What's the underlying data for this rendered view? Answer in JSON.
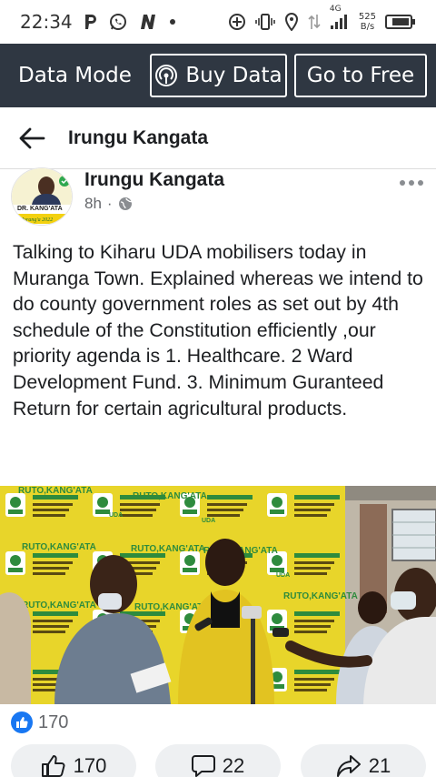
{
  "status_bar": {
    "time": "22:34",
    "network": "4G",
    "speed_value": "525",
    "speed_unit": "B/s"
  },
  "data_mode": {
    "label": "Data Mode",
    "buy_data": "Buy Data",
    "go_to_free": "Go to Free"
  },
  "header": {
    "title": "Irungu Kangata"
  },
  "post": {
    "author": "Irungu Kangata",
    "time": "8h",
    "avatar_caption": "DR. KANG'ATA",
    "avatar_sub": "Murang'a 2022",
    "text": "Talking to Kiharu  UDA mobilisers today in Muranga Town. Explained whereas we intend to do county government roles as set out by 4th schedule of the Constitution efficiently  ,our priority agenda is 1. Healthcare. 2 Ward Development Fund. 3. Minimum Guranteed Return for certain agricultural products.",
    "photo_banner_text": "RUTO,KANG'ATA",
    "photo_logo_text": "UDA",
    "reaction_count": "170"
  },
  "actions": {
    "like_count": "170",
    "comment_count": "22",
    "share_count": "21"
  },
  "colors": {
    "data_bar": "#2f3742",
    "like_blue": "#1877f2",
    "banner_yellow": "#e8d52a"
  }
}
